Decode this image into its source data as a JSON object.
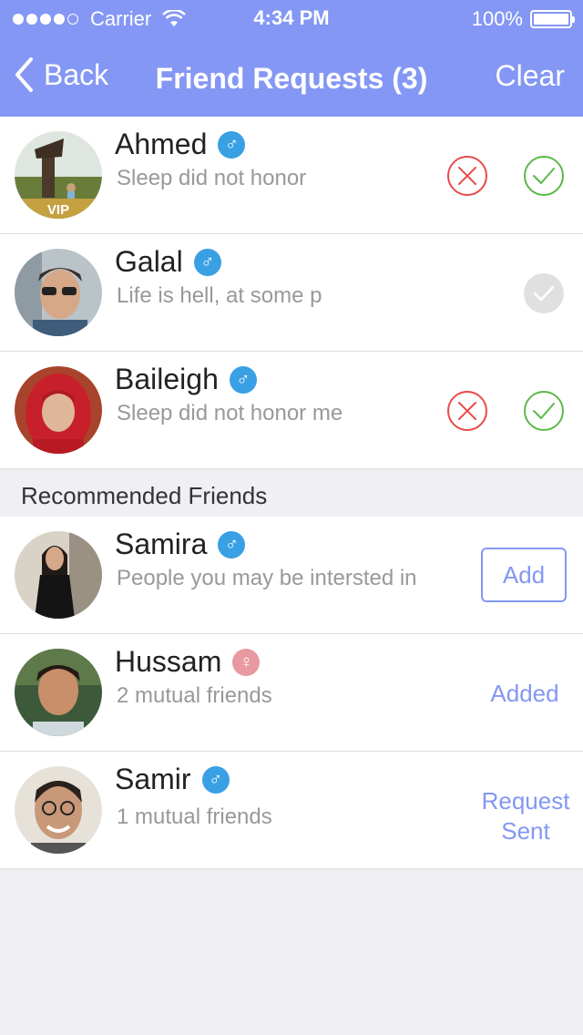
{
  "status_bar": {
    "carrier": "Carrier",
    "time": "4:34 PM",
    "battery": "100%"
  },
  "nav": {
    "back_label": "Back",
    "title": "Friend Requests (3)",
    "clear_label": "Clear"
  },
  "requests": [
    {
      "name": "Ahmed",
      "gender": "male",
      "subtitle": "Sleep did not honor",
      "badge": "VIP",
      "actions": [
        "decline",
        "accept"
      ]
    },
    {
      "name": "Galal",
      "gender": "male",
      "subtitle": "Life is hell, at some p",
      "actions": [
        "accepted"
      ]
    },
    {
      "name": "Baileigh",
      "gender": "male",
      "subtitle": "Sleep did not honor me",
      "actions": [
        "decline",
        "accept"
      ]
    }
  ],
  "recommended": {
    "header": "Recommended Friends",
    "items": [
      {
        "name": "Samira",
        "gender": "male",
        "subtitle": "People you may be intersted in",
        "action_label": "Add"
      },
      {
        "name": "Hussam",
        "gender": "female",
        "subtitle": "2 mutual friends",
        "action_label": "Added"
      },
      {
        "name": "Samir",
        "gender": "male",
        "subtitle": "1 mutual friends",
        "action_label_line1": "Request",
        "action_label_line2": "Sent"
      }
    ]
  },
  "colors": {
    "accent": "#8497f4",
    "male_badge": "#3aa0e4",
    "female_badge": "#e89aa0",
    "decline": "#e84a4a",
    "accept": "#5cb84a",
    "disabled": "#e0e0e0"
  },
  "icons": {
    "back": "chevron-left-icon",
    "decline": "x-circle-icon",
    "accept": "check-circle-icon",
    "male": "male-symbol-icon",
    "female": "female-symbol-icon"
  }
}
